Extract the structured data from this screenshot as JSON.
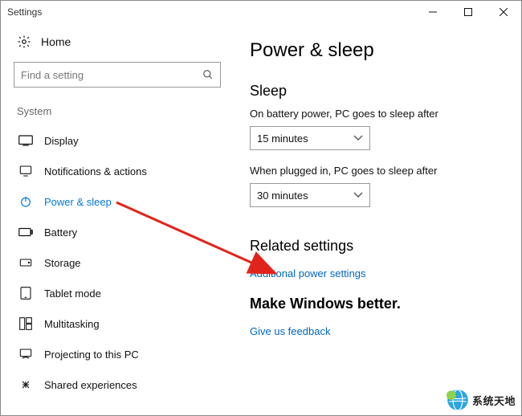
{
  "window": {
    "title": "Settings"
  },
  "home": {
    "label": "Home"
  },
  "search": {
    "placeholder": "Find a setting"
  },
  "sidebar": {
    "group": "System",
    "items": [
      {
        "label": "Display"
      },
      {
        "label": "Notifications & actions"
      },
      {
        "label": "Power & sleep"
      },
      {
        "label": "Battery"
      },
      {
        "label": "Storage"
      },
      {
        "label": "Tablet mode"
      },
      {
        "label": "Multitasking"
      },
      {
        "label": "Projecting to this PC"
      },
      {
        "label": "Shared experiences"
      }
    ]
  },
  "page": {
    "title": "Power & sleep",
    "sleep": {
      "heading": "Sleep",
      "battery_label": "On battery power, PC goes to sleep after",
      "battery_value": "15 minutes",
      "plugged_label": "When plugged in, PC goes to sleep after",
      "plugged_value": "30 minutes"
    },
    "related": {
      "heading": "Related settings",
      "link": "Additional power settings"
    },
    "feedback": {
      "heading": "Make Windows better.",
      "link": "Give us feedback"
    }
  },
  "watermark": {
    "text": "系统天地"
  }
}
